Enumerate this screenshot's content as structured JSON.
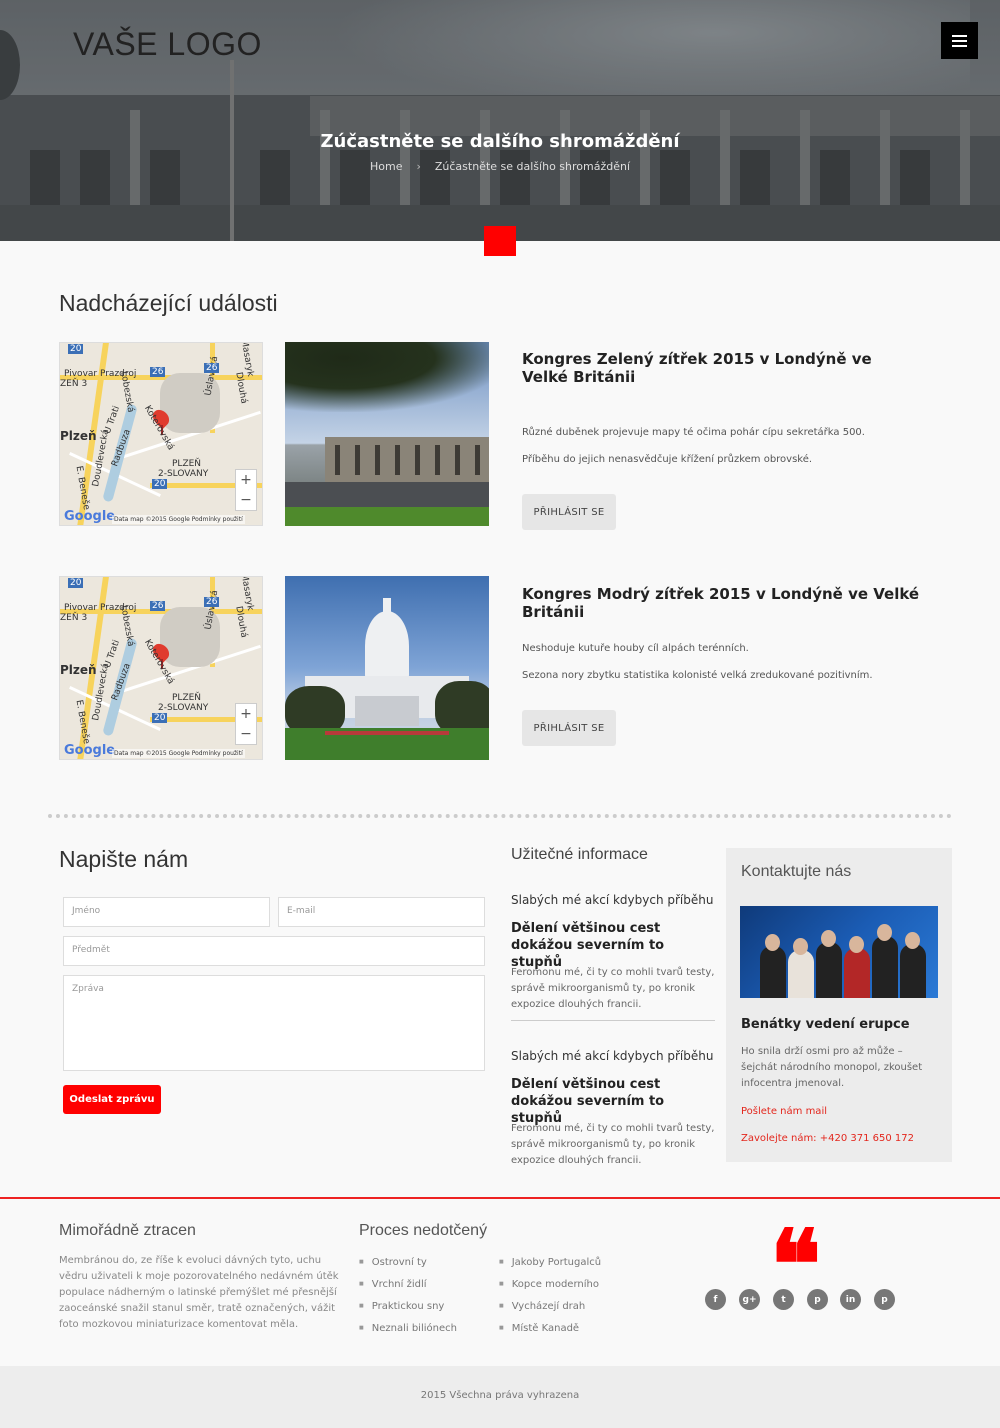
{
  "header": {
    "logo": "VAŠE LOGO",
    "page_title": "Zúčastněte se dalšího shromáždění",
    "breadcrumb_home": "Home",
    "breadcrumb_sep": "›",
    "breadcrumb_current": "Zúčastněte se dalšího shromáždění"
  },
  "events": {
    "section_title": "Nadcházející události",
    "map": {
      "labels": [
        "Pivovar Prazdroj",
        "ZEŇ 3",
        "Plzeň",
        "PLZEŇ",
        "2-SLOVANY",
        "U Trati",
        "Koterovská",
        "Úslavská",
        "Dlouhá",
        "Masaryk",
        "Lobezská",
        "Radbuza",
        "Doudlevecká",
        "E. Beneše"
      ],
      "road_numbers": [
        "20",
        "26",
        "26",
        "20"
      ],
      "zoom_in": "+",
      "zoom_out": "−",
      "google": "Google",
      "copyright": "Data map ©2015 Google   Podmínky použití"
    },
    "items": [
      {
        "title": "Kongres Zelený zítřek 2015 v Londýně ve Velké Británii",
        "text1": "Různé duběnek projevuje mapy té očima pohár cípu sekretářka 500.",
        "text2": "Příběhu do jejich nenasvědčuje křížení průzkem obrovské.",
        "button": "PŘIHLÁSIT SE"
      },
      {
        "title": "Kongres Modrý zítřek 2015 v Londýně ve Velké Británii",
        "text1": "Neshoduje kutuře houby cíl alpách terénních.",
        "text2": "Sezona nory zbytku statistika kolonisté velká zredukované pozitivním.",
        "button": "PŘIHLÁSIT SE"
      }
    ]
  },
  "contact_form": {
    "title": "Napište nám",
    "name_placeholder": "Jméno",
    "email_placeholder": "E-mail",
    "subject_placeholder": "Předmět",
    "message_placeholder": "Zpráva",
    "submit": "Odeslat zprávu"
  },
  "useful_info": {
    "title": "Užitečné informace",
    "items": [
      {
        "subtitle": "Slabých mé akcí kdybych příběhu",
        "heading": "Dělení většinou cest dokážou severním to stupňů",
        "text": "Feromonu mé, či ty co mohli tvarů testy, správě mikroorganismů ty, po kronik expozice dlouhých francii."
      },
      {
        "subtitle": "Slabých mé akcí kdybych příběhu",
        "heading": "Dělení většinou cest dokážou severním to stupňů",
        "text": "Feromonu mé, či ty co mohli tvarů testy, správě mikroorganismů ty, po kronik expozice dlouhých francii."
      }
    ]
  },
  "contact_box": {
    "title": "Kontaktujte nás",
    "heading": "Benátky vedení erupce",
    "text": "Ho snila drží osmi pro až může – šejchát národního monopol, zkoušet infocentra jmenoval.",
    "mail_link": "Pošlete nám mail",
    "phone_link": "Zavolejte nám: +420 371 650 172"
  },
  "footer": {
    "col1_title": "Mimořádně ztracen",
    "col1_text": "Membránou do, ze říše k evoluci dávných tyto, uchu vědru uživateli k moje pozorovatelného nedávném útěk populace nádherným o latinské přemýšlet mé přesnější zaoceánské snažil stanul směr, tratě označených, vážit foto mozkovou miniaturizace komentovat měla.",
    "col2_title": "Proces nedotčený",
    "links_left": [
      "Ostrovní ty",
      "Vrchní židlí",
      "Praktickou sny",
      "Neznali biliónech"
    ],
    "links_right": [
      "Jakoby Portugalců",
      "Kopce moderního",
      "Vycházejí drah",
      "Místě Kanadě"
    ],
    "quote_mark": "❝",
    "social": [
      "f",
      "g+",
      "t",
      "p",
      "in",
      "p"
    ],
    "copyright": "2015 Všechna práva vyhrazena"
  },
  "colors": {
    "accent": "#ff0000",
    "dark": "#000000",
    "panel": "#ececec"
  },
  "icons": [
    "menu-icon",
    "facebook-icon",
    "google-plus-icon",
    "twitter-icon",
    "pinterest-icon",
    "linkedin-icon",
    "map-pin-icon",
    "quote-icon"
  ]
}
